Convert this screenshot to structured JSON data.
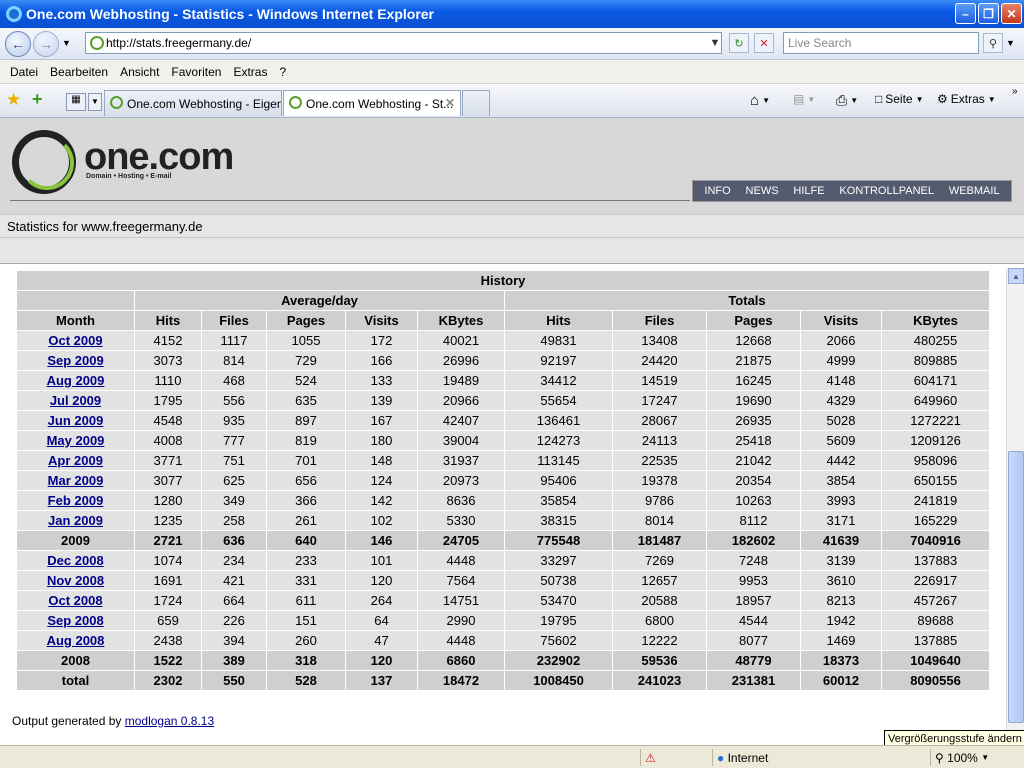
{
  "window": {
    "title": "One.com Webhosting - Statistics - Windows Internet Explorer"
  },
  "address": {
    "url": "http://stats.freegermany.de/",
    "search_placeholder": "Live Search"
  },
  "menu": [
    "Datei",
    "Bearbeiten",
    "Ansicht",
    "Favoriten",
    "Extras",
    "?"
  ],
  "tabs": [
    {
      "label": "One.com Webhosting - Eigen..."
    },
    {
      "label": "One.com Webhosting - St..."
    }
  ],
  "toolbar": {
    "page_label": "Seite",
    "tools_label": "Extras"
  },
  "brand": {
    "name": "one.com",
    "tagline": "Domain • Hosting • E-mail"
  },
  "nav": [
    "INFO",
    "NEWS",
    "HILFE",
    "KONTROLLPANEL",
    "WEBMAIL"
  ],
  "stats_for": "Statistics for www.freegermany.de",
  "history": {
    "title": "History",
    "group_avg": "Average/day",
    "group_totals": "Totals",
    "columns": [
      "Month",
      "Hits",
      "Files",
      "Pages",
      "Visits",
      "KBytes",
      "Hits",
      "Files",
      "Pages",
      "Visits",
      "KBytes"
    ],
    "rows": [
      {
        "month": "Oct 2009",
        "v": [
          "4152",
          "1117",
          "1055",
          "172",
          "40021",
          "49831",
          "13408",
          "12668",
          "2066",
          "480255"
        ]
      },
      {
        "month": "Sep 2009",
        "v": [
          "3073",
          "814",
          "729",
          "166",
          "26996",
          "92197",
          "24420",
          "21875",
          "4999",
          "809885"
        ]
      },
      {
        "month": "Aug 2009",
        "v": [
          "1110",
          "468",
          "524",
          "133",
          "19489",
          "34412",
          "14519",
          "16245",
          "4148",
          "604171"
        ]
      },
      {
        "month": "Jul 2009",
        "v": [
          "1795",
          "556",
          "635",
          "139",
          "20966",
          "55654",
          "17247",
          "19690",
          "4329",
          "649960"
        ]
      },
      {
        "month": "Jun 2009",
        "v": [
          "4548",
          "935",
          "897",
          "167",
          "42407",
          "136461",
          "28067",
          "26935",
          "5028",
          "1272221"
        ]
      },
      {
        "month": "May 2009",
        "v": [
          "4008",
          "777",
          "819",
          "180",
          "39004",
          "124273",
          "24113",
          "25418",
          "5609",
          "1209126"
        ]
      },
      {
        "month": "Apr 2009",
        "v": [
          "3771",
          "751",
          "701",
          "148",
          "31937",
          "113145",
          "22535",
          "21042",
          "4442",
          "958096"
        ]
      },
      {
        "month": "Mar 2009",
        "v": [
          "3077",
          "625",
          "656",
          "124",
          "20973",
          "95406",
          "19378",
          "20354",
          "3854",
          "650155"
        ]
      },
      {
        "month": "Feb 2009",
        "v": [
          "1280",
          "349",
          "366",
          "142",
          "8636",
          "35854",
          "9786",
          "10263",
          "3993",
          "241819"
        ]
      },
      {
        "month": "Jan 2009",
        "v": [
          "1235",
          "258",
          "261",
          "102",
          "5330",
          "38315",
          "8014",
          "8112",
          "3171",
          "165229"
        ]
      },
      {
        "month": "2009",
        "sum": true,
        "v": [
          "2721",
          "636",
          "640",
          "146",
          "24705",
          "775548",
          "181487",
          "182602",
          "41639",
          "7040916"
        ]
      },
      {
        "month": "Dec 2008",
        "v": [
          "1074",
          "234",
          "233",
          "101",
          "4448",
          "33297",
          "7269",
          "7248",
          "3139",
          "137883"
        ]
      },
      {
        "month": "Nov 2008",
        "v": [
          "1691",
          "421",
          "331",
          "120",
          "7564",
          "50738",
          "12657",
          "9953",
          "3610",
          "226917"
        ]
      },
      {
        "month": "Oct 2008",
        "v": [
          "1724",
          "664",
          "611",
          "264",
          "14751",
          "53470",
          "20588",
          "18957",
          "8213",
          "457267"
        ]
      },
      {
        "month": "Sep 2008",
        "v": [
          "659",
          "226",
          "151",
          "64",
          "2990",
          "19795",
          "6800",
          "4544",
          "1942",
          "89688"
        ]
      },
      {
        "month": "Aug 2008",
        "v": [
          "2438",
          "394",
          "260",
          "47",
          "4448",
          "75602",
          "12222",
          "8077",
          "1469",
          "137885"
        ]
      },
      {
        "month": "2008",
        "sum": true,
        "v": [
          "1522",
          "389",
          "318",
          "120",
          "6860",
          "232902",
          "59536",
          "48779",
          "18373",
          "1049640"
        ]
      },
      {
        "month": "total",
        "sum": true,
        "v": [
          "2302",
          "550",
          "528",
          "137",
          "18472",
          "1008450",
          "241023",
          "231381",
          "60012",
          "8090556"
        ]
      }
    ]
  },
  "footer": {
    "prefix": "Output generated by ",
    "link": "modlogan 0.8.13"
  },
  "tooltip": "Vergrößerungsstufe ändern",
  "status": {
    "zone": "Internet",
    "zoom": "100%"
  }
}
